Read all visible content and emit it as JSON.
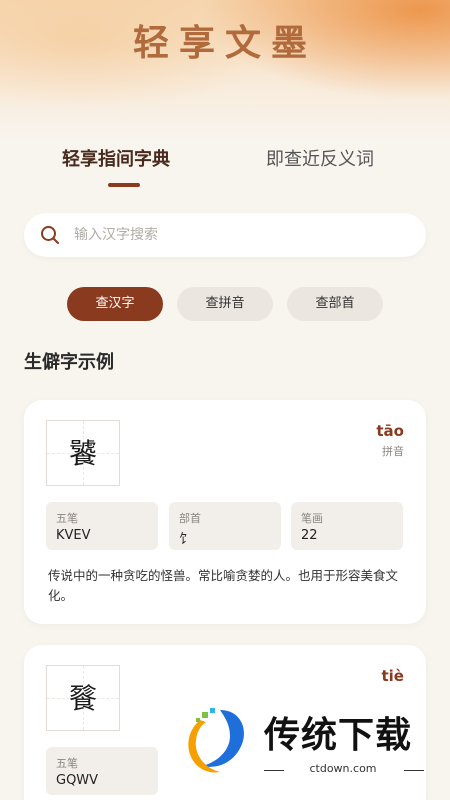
{
  "app_title": "轻享文墨",
  "tabs": [
    {
      "label": "轻享指间字典",
      "active": true
    },
    {
      "label": "即查近反义词",
      "active": false
    }
  ],
  "search": {
    "placeholder": "输入汉字搜索",
    "value": ""
  },
  "modes": [
    {
      "label": "查汉字",
      "active": true
    },
    {
      "label": "查拼音",
      "active": false
    },
    {
      "label": "查部首",
      "active": false
    }
  ],
  "section_title": "生僻字示例",
  "cards": [
    {
      "char": "饕",
      "pinyin": "tāo",
      "pinyin_label": "拼音",
      "wubi_label": "五笔",
      "wubi": "KVEV",
      "radical_label": "部首",
      "radical": "饣",
      "strokes_label": "笔画",
      "strokes": "22",
      "desc": "传说中的一种贪吃的怪兽。常比喻贪婪的人。也用于形容美食文化。"
    },
    {
      "char": "餮",
      "pinyin": "tiè",
      "wubi_label": "五笔",
      "wubi": "GQWV"
    }
  ],
  "watermark": {
    "text": "传统下载",
    "domain": "ctdown.com"
  },
  "colors": {
    "accent": "#8a3a1e",
    "title": "#b06a3c",
    "background": "#f8f4ee"
  }
}
